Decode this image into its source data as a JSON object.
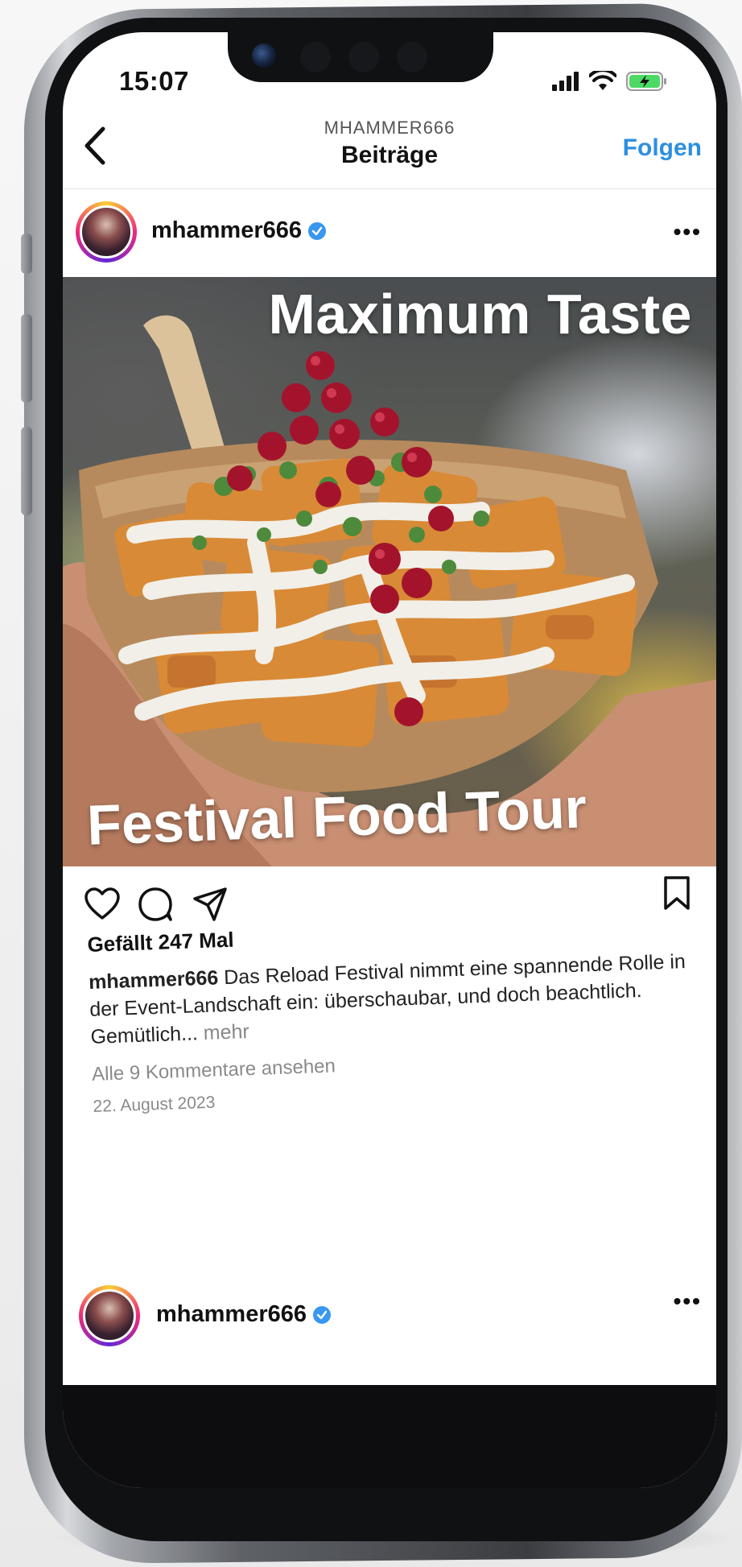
{
  "status_bar": {
    "time": "15:07"
  },
  "header": {
    "subtitle": "MHAMMER666",
    "title": "Beiträge",
    "follow_label": "Folgen"
  },
  "post": {
    "username": "mhammer666",
    "overlay_top": "Maximum Taste",
    "overlay_bottom": "Festival Food Tour",
    "likes": "Gefällt 247 Mal",
    "caption_user": "mhammer666",
    "caption_text": " Das Reload Festival nimmt eine spannende Rolle in der Event-Landschaft ein: überschaubar, und doch beachtlich. Gemütlich...",
    "caption_more": " mehr",
    "comments_link": "Alle 9 Kommentare ansehen",
    "date": "22. August 2023"
  },
  "next_post": {
    "username": "mhammer666"
  },
  "colors": {
    "accent": "#2d8fe0",
    "verified": "#3897f0"
  },
  "icons": {
    "back": "chevron-left-icon",
    "more": "more-horizontal-icon",
    "like": "heart-icon",
    "comment": "comment-icon",
    "share": "paper-plane-icon",
    "save": "bookmark-icon"
  }
}
